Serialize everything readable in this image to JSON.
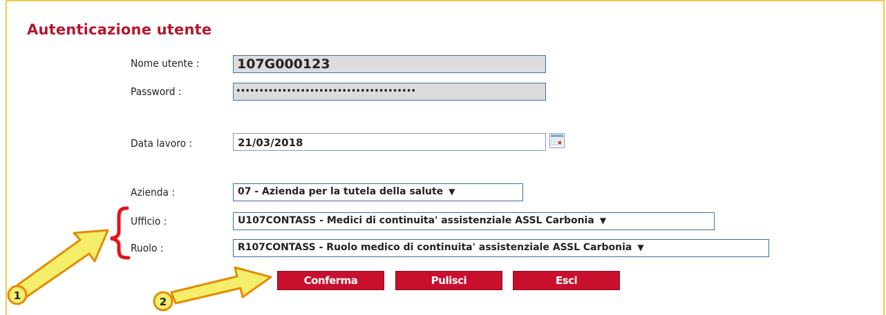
{
  "form": {
    "title": "Autenticazione utente",
    "username_label": "Nome utente :",
    "username_value": "107G000123",
    "password_label": "Password :",
    "password_value": "•••••••••••••••••••••••••••••••••••••••",
    "date_label": "Data lavoro :",
    "date_value": "21/03/2018",
    "azienda_label": "Azienda :",
    "azienda_value": "07 - Azienda per la tutela della salute",
    "ufficio_label": "Ufficio :",
    "ufficio_value": "U107CONTASS - Medici di continuita' assistenziale ASSL Carbonia",
    "ruolo_label": "Ruolo :",
    "ruolo_value": "R107CONTASS - Ruolo medico di continuita' assistenziale ASSL Carbonia"
  },
  "buttons": {
    "confirm": "Conferma",
    "clear": "Pulisci",
    "exit": "Esci"
  },
  "annotations": {
    "marker1": "1",
    "marker2": "2"
  },
  "colors": {
    "title": "#b5172e",
    "button": "#c8102e",
    "frame": "#f2c94c",
    "annotation_arrow": "#f5ee6b",
    "annotation_bracket": "#e8101a"
  },
  "icons": {
    "calendar": "calendar-icon",
    "dropdown": "dropdown-arrow-icon"
  }
}
